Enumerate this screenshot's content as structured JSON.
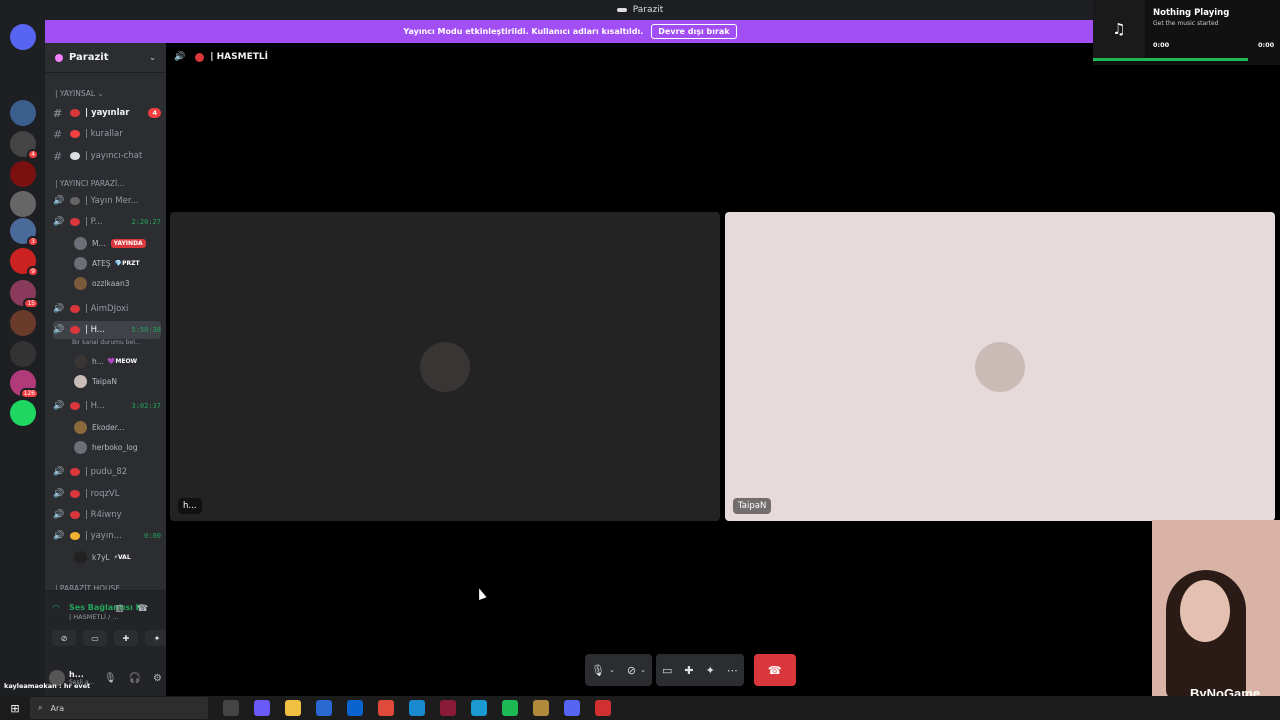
{
  "titlebar": {
    "title": "Parazit"
  },
  "banner": {
    "text": "Yayıncı Modu etkinleştirildi. Kullanıcı adları kısaltıldı.",
    "button": "Devre dışı bırak"
  },
  "servers": [
    {
      "color": "#5865f2",
      "badge": "1"
    },
    {
      "color": "#3a5f8c",
      "badge": ""
    },
    {
      "color": "#444444",
      "badge": "4"
    },
    {
      "color": "#7a1010",
      "badge": ""
    },
    {
      "color": "#666666",
      "badge": ""
    },
    {
      "color": "#4a6a9a",
      "badge": "3"
    },
    {
      "color": "#cc2222",
      "badge": "9"
    },
    {
      "color": "#8a3a5a",
      "badge": "15"
    },
    {
      "color": "#6a3a2a",
      "badge": ""
    },
    {
      "color": "#333333",
      "badge": ""
    },
    {
      "color": "#b03a7a",
      "badge": "126"
    },
    {
      "color": "#1ed760",
      "badge": ""
    }
  ],
  "guild": {
    "name": "Parazit"
  },
  "sidebar": {
    "cat1": "| YAYINSAL ⌄",
    "ch_yayinlar": "| yayınlar",
    "ch_yayinlar_count": "4",
    "ch_kurallar": "| kurallar",
    "ch_chat": "| yayıncı-chat",
    "cat2": "| YAYINCI PARAZİ...",
    "ch_mer": "| Yayın Mer...",
    "ch_p": "| P...",
    "ch_p_time": "2:20:27",
    "u_m": "M...",
    "u_m_live": "YAYINDA",
    "u_ates": "ATEŞ",
    "u_ates_tag": "💎PRZT",
    "u_ozz": "ozzlkaan3",
    "ch_aim": "| AimDJoxi",
    "ch_h1": "| H...",
    "ch_h1_time": "5:50:38",
    "ch_h1_status": "Bir kanal durumu bel...",
    "u_h": "h...",
    "u_h_tag": "💜MEOW",
    "u_taipan": "TaipaN",
    "ch_h2": "| H...",
    "ch_h2_time": "3:02:37",
    "u_ekoder": "Ekoder...",
    "u_herboko": "herboko_log",
    "ch_pudu": "| pudu_82",
    "ch_roqz": "| roqzVL",
    "ch_r4": "| R4iwny",
    "ch_yayin": "| yayın...",
    "ch_yayin_time": "0:00",
    "u_k7": "k7yL",
    "u_k7_tag": "⚡VAL",
    "cat3": "| PARAZİT HOUSE"
  },
  "voice": {
    "connected": "Ses Bağlantısı K",
    "channel": "| HASMETLİ / ...",
    "username": "h...",
    "sub": "Sesli a..."
  },
  "chat_overlay": "kayleamaokan : hr evet",
  "main": {
    "channel_title": "| HASMETLİ",
    "tiles": [
      {
        "name": "h...",
        "bg": "#232323",
        "avatar": "#3a3535"
      },
      {
        "name": "TaipaN",
        "bg": "#e6dada",
        "avatar": "#c9bcb6"
      }
    ]
  },
  "now_playing": {
    "title": "Nothing Playing",
    "subtitle": "Get the music started",
    "time_start": "0:00",
    "time_end": "0:00"
  },
  "watermark": "ByNoGame",
  "taskbar": {
    "search": "Ara"
  }
}
